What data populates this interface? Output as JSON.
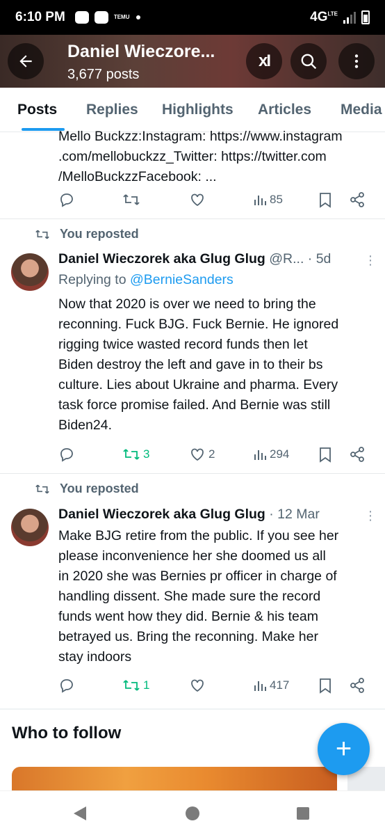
{
  "status_bar": {
    "time": "6:10 PM",
    "app_badge": "TEMU",
    "network": "4G",
    "network_sup": "LTE"
  },
  "header": {
    "title": "Daniel Wieczore...",
    "posts_count": "3,677 posts",
    "xai_label": "xI"
  },
  "tabs": [
    "Posts",
    "Replies",
    "Highlights",
    "Articles",
    "Media"
  ],
  "tweet0": {
    "lines": [
      "Mello Buckzz:Instagram: https://www.instagram",
      ".com/mellobuckzz_Twitter: https://twitter.com",
      "/MelloBuckzzFacebook: ..."
    ],
    "views": "85"
  },
  "tweet1": {
    "reposted_label": "You reposted",
    "name": "Daniel Wieczorek aka Glug Glug",
    "handle_time": "@R... · 5d",
    "replying_prefix": "Replying to",
    "replying_handle": "@BernieSanders",
    "lines": [
      "Now that 2020 is over we need to bring the",
      "reconning. Fuck BJG. Fuck Bernie. He ignored",
      "rigging twice wasted record funds then let",
      "Biden destroy the left and gave in to their bs",
      "culture. Lies about Ukraine and pharma. Every",
      "task force promise failed. And Bernie was still",
      "Biden24."
    ],
    "reposts": "3",
    "likes": "2",
    "views": "294"
  },
  "tweet2": {
    "reposted_label": "You reposted",
    "name": "Daniel Wieczorek aka Glug Glug",
    "handle_time": "· 12 Mar",
    "lines": [
      "Make BJG retire from the public. If you see her",
      "please inconvenience her she doomed us all",
      "in 2020 she was Bernies pr officer in charge of",
      "handling dissent. She made sure the record",
      "funds went how they did. Bernie & his team",
      "betrayed us. Bring the reconning. Make her",
      "stay indoors"
    ],
    "reposts": "1",
    "views": "417"
  },
  "who_to_follow": "Who to follow",
  "fab_label": "+",
  "colors": {
    "accent": "#1d9bf0",
    "repost_green": "#00ba7c",
    "muted": "#536471"
  }
}
